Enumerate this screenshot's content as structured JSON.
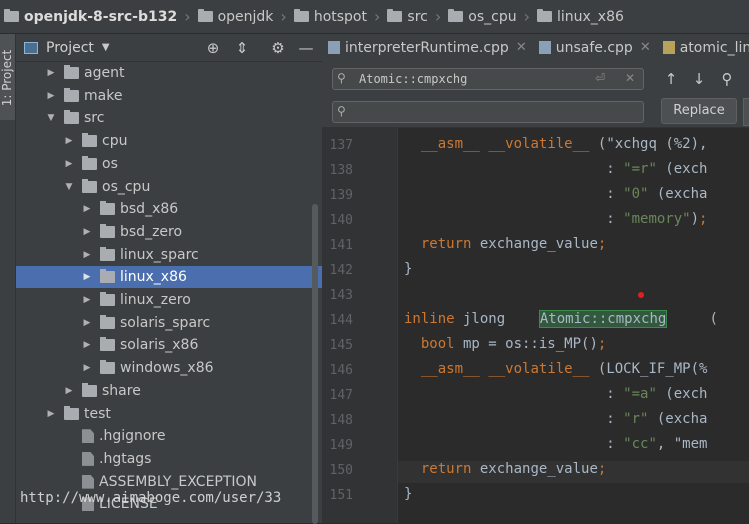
{
  "breadcrumb": {
    "items": [
      "openjdk-8-src-b132",
      "openjdk",
      "hotspot",
      "src",
      "os_cpu",
      "linux_x86"
    ]
  },
  "stripe": {
    "label": "1: Project"
  },
  "project": {
    "title": "Project",
    "tree": [
      {
        "label": "agent",
        "expanded": false
      },
      {
        "label": "make",
        "expanded": false
      },
      {
        "label": "src",
        "expanded": true
      },
      {
        "label": "cpu",
        "expanded": false
      },
      {
        "label": "os",
        "expanded": false
      },
      {
        "label": "os_cpu",
        "expanded": true
      },
      {
        "label": "bsd_x86",
        "expanded": false
      },
      {
        "label": "bsd_zero",
        "expanded": false
      },
      {
        "label": "linux_sparc",
        "expanded": false
      },
      {
        "label": "linux_x86",
        "expanded": false,
        "selected": true
      },
      {
        "label": "linux_zero",
        "expanded": false
      },
      {
        "label": "solaris_sparc",
        "expanded": false
      },
      {
        "label": "solaris_x86",
        "expanded": false
      },
      {
        "label": "windows_x86",
        "expanded": false
      },
      {
        "label": "share",
        "expanded": false
      },
      {
        "label": "test",
        "expanded": false
      },
      {
        "label": ".hgignore"
      },
      {
        "label": ".hgtags"
      },
      {
        "label": "ASSEMBLY_EXCEPTION"
      },
      {
        "label": "LICENSE"
      }
    ]
  },
  "tabs": [
    {
      "label": "interpreterRuntime.cpp"
    },
    {
      "label": "unsafe.cpp"
    },
    {
      "label": "atomic_linu"
    }
  ],
  "find": {
    "search_value": "Atomic::cmpxchg",
    "replace_value": "",
    "replace_label": "Replace"
  },
  "code": {
    "lines": [
      {
        "num": "137",
        "text": "  __asm__ __volatile__ (\"xchgq (%2),"
      },
      {
        "num": "138",
        "text": "                        : \"=r\" (exch"
      },
      {
        "num": "139",
        "text": "                        : \"0\" (excha"
      },
      {
        "num": "140",
        "text": "                        : \"memory\");"
      },
      {
        "num": "141",
        "text": "  return exchange_value;"
      },
      {
        "num": "142",
        "text": "}"
      },
      {
        "num": "143",
        "text": ""
      },
      {
        "num": "144",
        "text": "inline jlong    Atomic::cmpxchg     ("
      },
      {
        "num": "145",
        "text": "  bool mp = os::is_MP();"
      },
      {
        "num": "146",
        "text": "  __asm__ __volatile__ (LOCK_IF_MP(%"
      },
      {
        "num": "147",
        "text": "                        : \"=a\" (exch"
      },
      {
        "num": "148",
        "text": "                        : \"r\" (excha"
      },
      {
        "num": "149",
        "text": "                        : \"cc\", \"mem"
      },
      {
        "num": "150",
        "text": "  return exchange_value;"
      },
      {
        "num": "151",
        "text": "}"
      }
    ]
  },
  "watermark": "http://www.aimaboge.com/user/33"
}
